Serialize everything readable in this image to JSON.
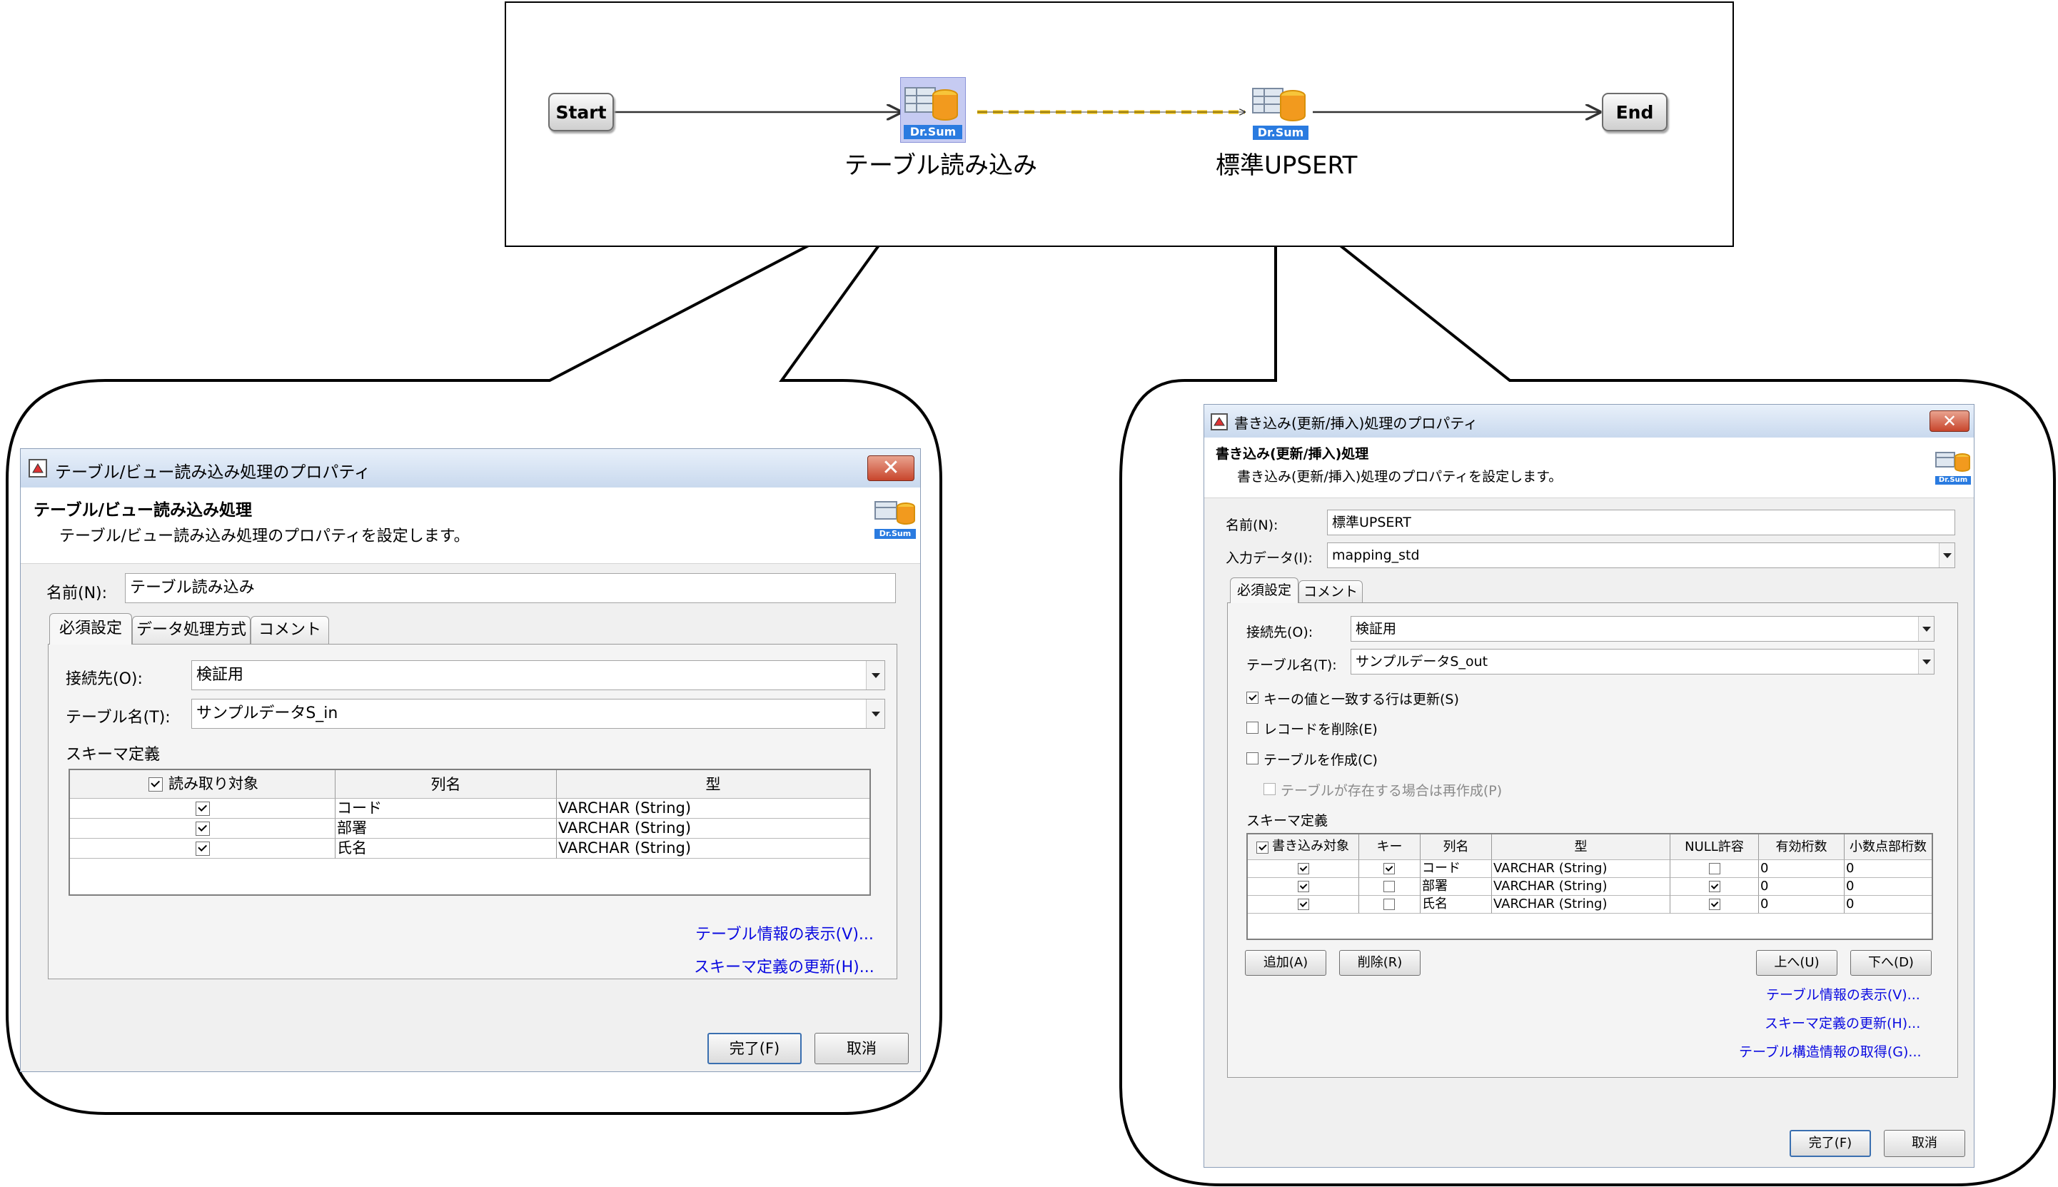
{
  "flow": {
    "start_label": "Start",
    "end_label": "End",
    "node1_label": "テーブル読み込み",
    "node2_label": "標準UPSERT",
    "badge": "Dr.Sum"
  },
  "left_dialog": {
    "title": "テーブル/ビュー読み込み処理のプロパティ",
    "header_title": "テーブル/ビュー読み込み処理",
    "header_desc": "テーブル/ビュー読み込み処理のプロパティを設定します。",
    "name_label": "名前(N):",
    "name_value": "テーブル読み込み",
    "tabs": [
      "必須設定",
      "データ処理方式",
      "コメント"
    ],
    "conn_label": "接続先(O):",
    "conn_value": "検証用",
    "table_label": "テーブル名(T):",
    "table_value": "サンプルデータS_in",
    "schema_label": "スキーマ定義",
    "columns": [
      "読み取り対象",
      "列名",
      "型"
    ],
    "rows": [
      {
        "target": true,
        "name": "コード",
        "type": "VARCHAR (String)"
      },
      {
        "target": true,
        "name": "部署",
        "type": "VARCHAR (String)"
      },
      {
        "target": true,
        "name": "氏名",
        "type": "VARCHAR (String)"
      }
    ],
    "link_table_info": "テーブル情報の表示(V)...",
    "link_schema_update": "スキーマ定義の更新(H)...",
    "ok": "完了(F)",
    "cancel": "取消"
  },
  "right_dialog": {
    "title": "書き込み(更新/挿入)処理のプロパティ",
    "header_title": "書き込み(更新/挿入)処理",
    "header_desc": "書き込み(更新/挿入)処理のプロパティを設定します。",
    "name_label": "名前(N):",
    "name_value": "標準UPSERT",
    "input_label": "入力データ(I):",
    "input_value": "mapping_std",
    "tabs": [
      "必須設定",
      "コメント"
    ],
    "conn_label": "接続先(O):",
    "conn_value": "検証用",
    "table_label": "テーブル名(T):",
    "table_value": "サンプルデータS_out",
    "opt_update": "キーの値と一致する行は更新(S)",
    "opt_delete": "レコードを削除(E)",
    "opt_create": "テーブルを作成(C)",
    "opt_recreate": "テーブルが存在する場合は再作成(P)",
    "opt_update_checked": true,
    "opt_delete_checked": false,
    "opt_create_checked": false,
    "opt_recreate_checked": false,
    "schema_label": "スキーマ定義",
    "columns": [
      "書き込み対象",
      "キー",
      "列名",
      "型",
      "NULL許容",
      "有効桁数",
      "小数点部桁数"
    ],
    "rows": [
      {
        "target": true,
        "key": true,
        "name": "コード",
        "type": "VARCHAR (String)",
        "nullable": false,
        "precision": "0",
        "scale": "0"
      },
      {
        "target": true,
        "key": false,
        "name": "部署",
        "type": "VARCHAR (String)",
        "nullable": true,
        "precision": "0",
        "scale": "0"
      },
      {
        "target": true,
        "key": false,
        "name": "氏名",
        "type": "VARCHAR (String)",
        "nullable": true,
        "precision": "0",
        "scale": "0"
      }
    ],
    "btn_add": "追加(A)",
    "btn_delete": "削除(R)",
    "btn_up": "上へ(U)",
    "btn_down": "下へ(D)",
    "link_table_info": "テーブル情報の表示(V)...",
    "link_schema_update": "スキーマ定義の更新(H)...",
    "link_struct": "テーブル構造情報の取得(G)...",
    "ok": "完了(F)",
    "cancel": "取消"
  },
  "colors": {
    "title_gradient_top": "#e8f0fa",
    "title_gradient_bottom": "#c9d9ee",
    "close_button": "#c8452c",
    "link": "#0a0ae0",
    "dr_sum_badge": "#2a7be0",
    "flow_arrow_dashed": "#e8b800"
  }
}
